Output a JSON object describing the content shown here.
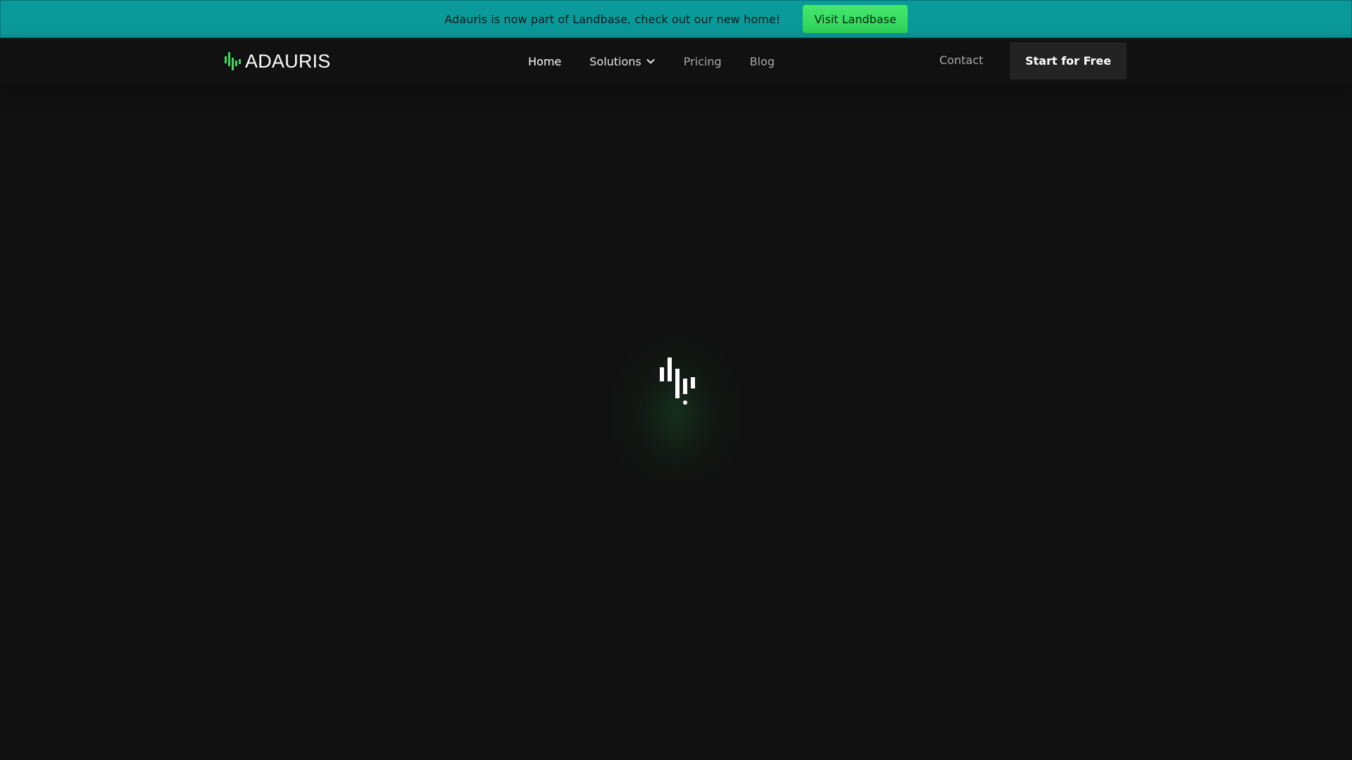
{
  "announcement": {
    "text": "Adauris is now part of Landbase, check out our new home!",
    "button_label": "Visit Landbase"
  },
  "nav": {
    "logo_text": "ADAURIS",
    "links": [
      {
        "label": "Home"
      },
      {
        "label": "Solutions"
      },
      {
        "label": "Pricing"
      },
      {
        "label": "Blog"
      }
    ],
    "contact_label": "Contact",
    "cta_label": "Start for Free"
  },
  "icons": {
    "logo": "adauris-bars-icon",
    "solutions_dropdown": "chevron-down-icon",
    "loader": "adauris-bars-icon"
  },
  "colors": {
    "banner_bg": "#0a9a99",
    "banner_button": "#3ddc64",
    "page_bg": "#111111",
    "logo_accent": "#3fd75f",
    "cta_bg": "#232323"
  }
}
